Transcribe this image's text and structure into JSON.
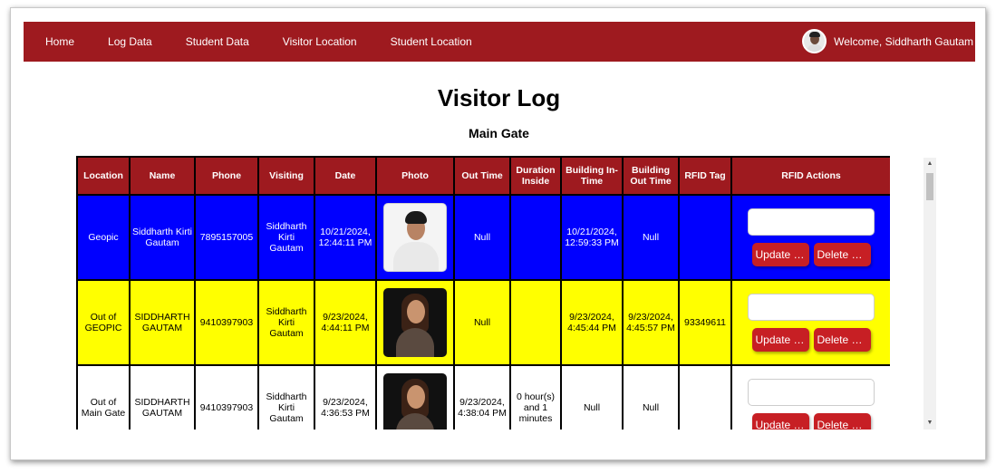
{
  "nav": {
    "links": [
      "Home",
      "Log Data",
      "Student Data",
      "Visitor Location",
      "Student Location"
    ],
    "welcome": "Welcome, Siddharth Gautam"
  },
  "page": {
    "title": "Visitor Log",
    "subtitle": "Main Gate"
  },
  "table": {
    "headers": [
      "Location",
      "Name",
      "Phone",
      "Visiting",
      "Date",
      "Photo",
      "Out Time",
      "Duration Inside",
      "Building In-Time",
      "Building Out Time",
      "RFID Tag",
      "RFID Actions"
    ],
    "rows": [
      {
        "location": "Geopic",
        "name": "Siddharth Kirti Gautam",
        "phone": "7895157005",
        "visiting": "Siddharth Kirti Gautam",
        "date": "10/21/2024, 12:44:11 PM",
        "photo": "man-light-background",
        "out_time": "Null",
        "duration": "",
        "building_in": "10/21/2024, 12:59:33 PM",
        "building_out": "Null",
        "rfid_tag": "",
        "update_label": "Update R...",
        "delete_label": "Delete R..."
      },
      {
        "location": "Out of GEOPIC",
        "name": "SIDDHARTH GAUTAM",
        "phone": "9410397903",
        "visiting": "Siddharth Kirti Gautam",
        "date": "9/23/2024, 4:44:11 PM",
        "photo": "woman-dark-background",
        "out_time": "Null",
        "duration": "",
        "building_in": "9/23/2024, 4:45:44 PM",
        "building_out": "9/23/2024, 4:45:57 PM",
        "rfid_tag": "93349611",
        "update_label": "Update R...",
        "delete_label": "Delete R..."
      },
      {
        "location": "Out of Main Gate",
        "name": "SIDDHARTH GAUTAM",
        "phone": "9410397903",
        "visiting": "Siddharth Kirti Gautam",
        "date": "9/23/2024, 4:36:53 PM",
        "photo": "woman-dark-background",
        "out_time": "9/23/2024, 4:38:04 PM",
        "duration": "0 hour(s) and 1 minutes",
        "building_in": "Null",
        "building_out": "Null",
        "rfid_tag": "",
        "update_label": "Update R...",
        "delete_label": "Delete R..."
      }
    ]
  },
  "colors": {
    "navbar": "#9e1a1f",
    "header": "#9e1a1f",
    "row_blue": "#0000ff",
    "row_yellow": "#ffff00",
    "button": "#c71f24"
  }
}
